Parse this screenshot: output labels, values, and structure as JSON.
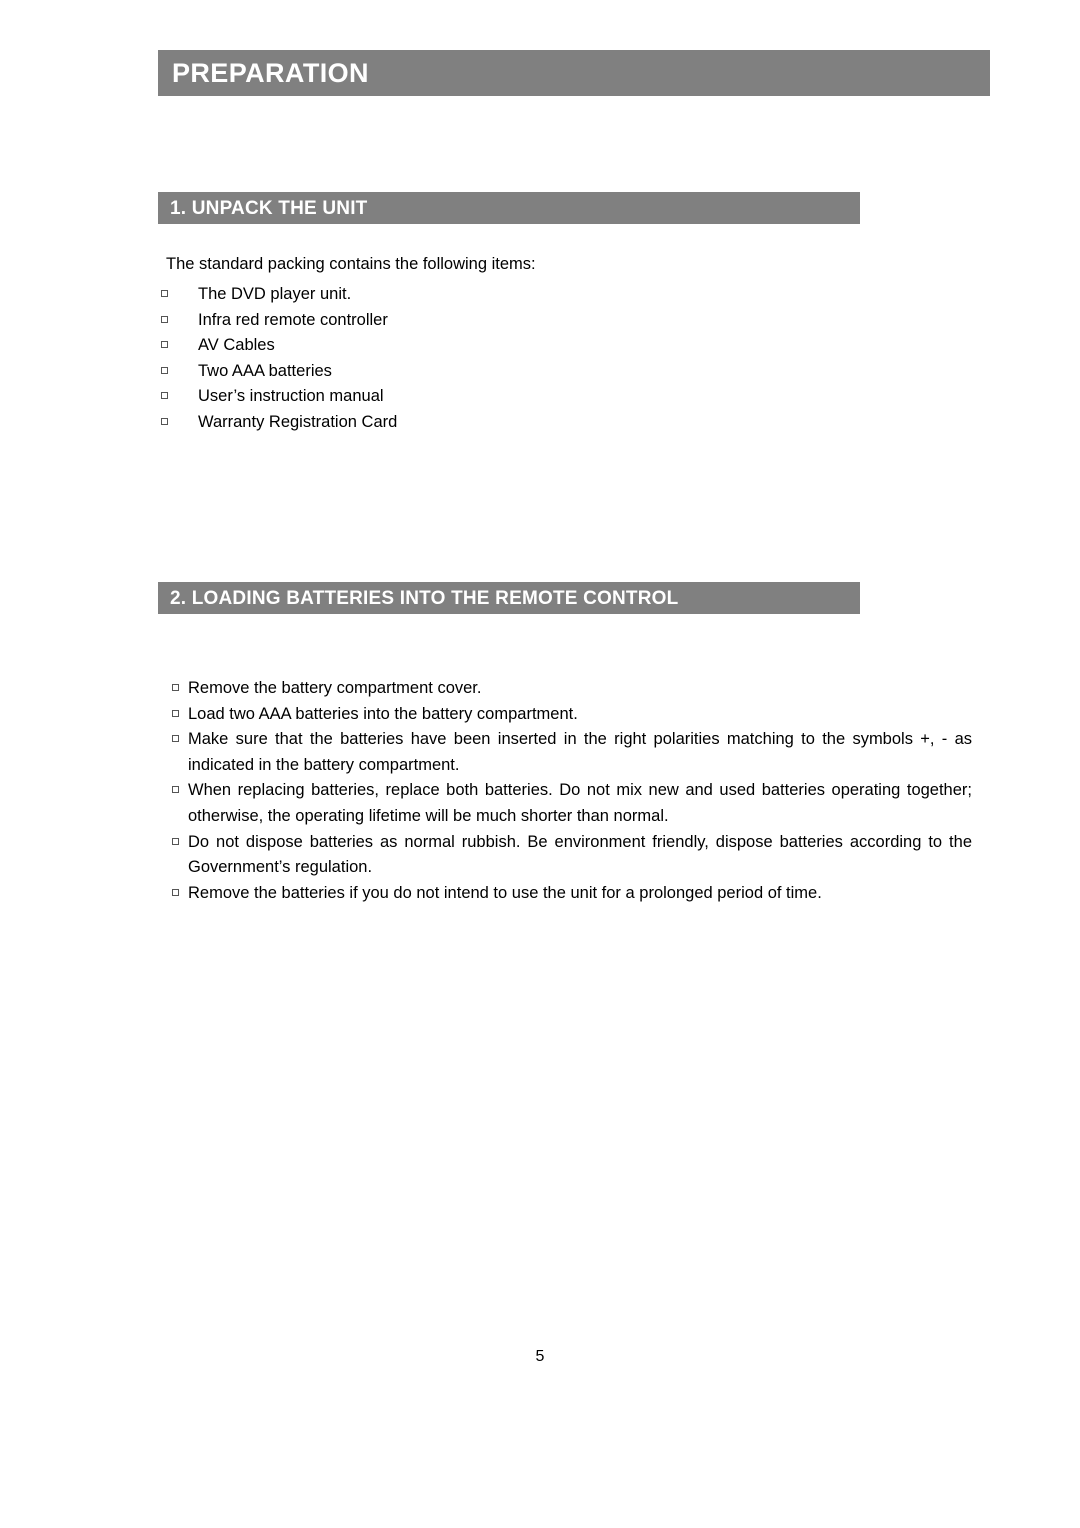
{
  "document": {
    "chapter_title": "PREPARATION",
    "page_number": "5",
    "sections": [
      {
        "heading": "1. UNPACK THE UNIT",
        "intro": "The standard packing contains the following items:",
        "items": [
          "The DVD player unit.",
          "Infra red remote controller",
          "AV Cables",
          "Two AAA batteries",
          "User’s instruction manual",
          "Warranty Registration Card"
        ]
      },
      {
        "heading": "2. LOADING BATTERIES INTO THE REMOTE CONTROL",
        "items": [
          "Remove the battery compartment cover.",
          "Load two AAA batteries into the battery compartment.",
          "Make sure that the batteries have been inserted in the right polarities matching to the symbols +, - as indicated in the battery compartment.",
          "When replacing batteries, replace both batteries. Do not mix new and used batteries operating together; otherwise, the operating lifetime will be much shorter than normal.",
          "Do not dispose batteries as normal rubbish. Be environment friendly, dispose batteries according to the Government’s regulation.",
          "Remove the batteries if you do not intend to use the unit for a prolonged period of time."
        ]
      }
    ]
  }
}
